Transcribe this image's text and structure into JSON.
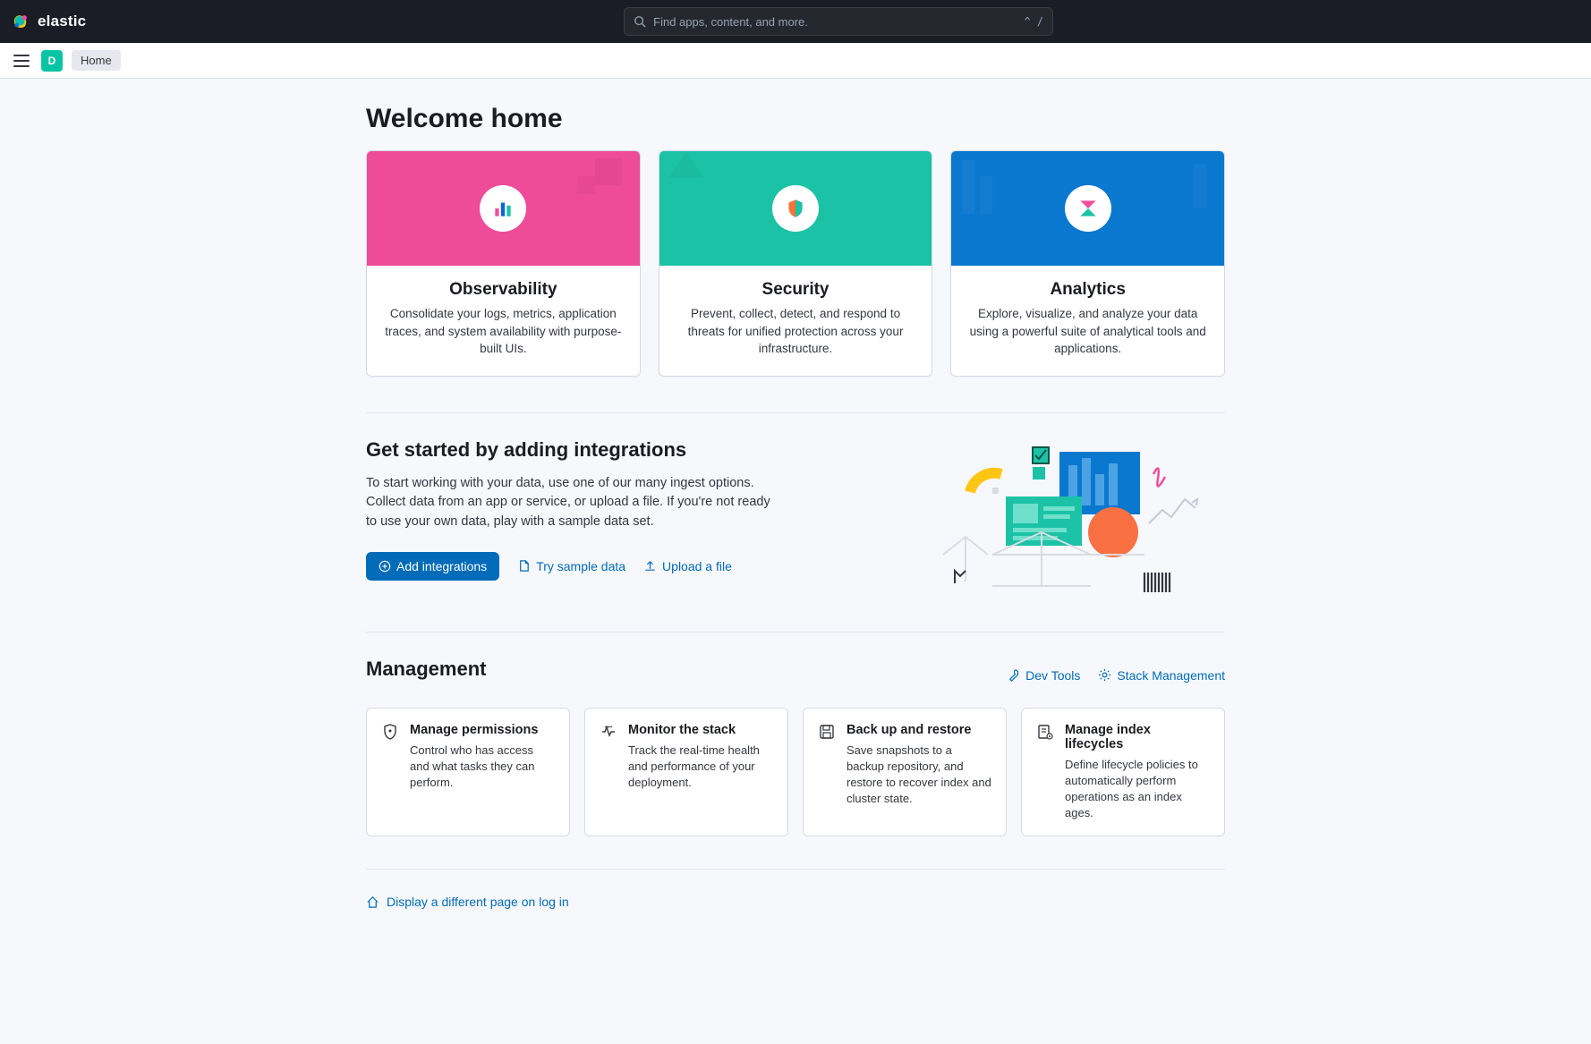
{
  "header": {
    "brand": "elastic",
    "search_placeholder": "Find apps, content, and more.",
    "search_shortcut": "^ /"
  },
  "subheader": {
    "workspace_initial": "D",
    "breadcrumb": "Home"
  },
  "page": {
    "title": "Welcome home"
  },
  "solutions": [
    {
      "title": "Observability",
      "desc": "Consolidate your logs, metrics, application traces, and system availability with purpose-built UIs.",
      "hero_class": "hero-pink"
    },
    {
      "title": "Security",
      "desc": "Prevent, collect, detect, and respond to threats for unified protection across your infrastructure.",
      "hero_class": "hero-teal"
    },
    {
      "title": "Analytics",
      "desc": "Explore, visualize, and analyze your data using a powerful suite of analytical tools and applications.",
      "hero_class": "hero-blue"
    }
  ],
  "integrations": {
    "title": "Get started by adding integrations",
    "para": "To start working with your data, use one of our many ingest options. Collect data from an app or service, or upload a file. If you're not ready to use your own data, play with a sample data set.",
    "add_btn": "Add integrations",
    "sample_btn": "Try sample data",
    "upload_btn": "Upload a file"
  },
  "management": {
    "title": "Management",
    "devtools_link": "Dev Tools",
    "stack_link": "Stack Management",
    "cards": [
      {
        "title": "Manage permissions",
        "desc": "Control who has access and what tasks they can perform."
      },
      {
        "title": "Monitor the stack",
        "desc": "Track the real-time health and performance of your deployment."
      },
      {
        "title": "Back up and restore",
        "desc": "Save snapshots to a backup repository, and restore to recover index and cluster state."
      },
      {
        "title": "Manage index lifecycles",
        "desc": "Define lifecycle policies to automatically perform operations as an index ages."
      }
    ]
  },
  "footer": {
    "change_home": "Display a different page on log in"
  }
}
